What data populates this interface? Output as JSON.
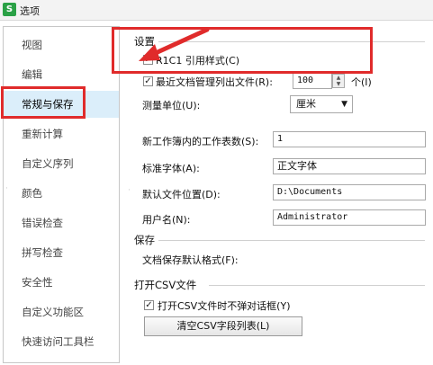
{
  "window": {
    "app_icon_letter": "S",
    "title": "选项"
  },
  "sidebar": {
    "items": [
      {
        "label": "视图"
      },
      {
        "label": "编辑"
      },
      {
        "label": "常规与保存"
      },
      {
        "label": "重新计算"
      },
      {
        "label": "自定义序列"
      },
      {
        "label": "颜色"
      },
      {
        "label": "错误检查"
      },
      {
        "label": "拼写检查"
      },
      {
        "label": "安全性"
      },
      {
        "label": "自定义功能区"
      },
      {
        "label": "快速访问工具栏"
      }
    ],
    "selected_index": 2
  },
  "settings": {
    "section_label": "设置",
    "r1c1": {
      "label": "R1C1 引用样式(C)",
      "checked": true
    },
    "recent_files": {
      "label": "最近文档管理列出文件(R):",
      "value": "100",
      "unit": "个(I)",
      "checked": true
    },
    "measure_unit": {
      "label": "测量单位(U):",
      "value": "厘米"
    },
    "sheets_count": {
      "label": "新工作簿内的工作表数(S):",
      "value": "1"
    },
    "standard_font": {
      "label": "标准字体(A):",
      "value": "正文字体"
    },
    "default_location": {
      "label": "默认文件位置(D):",
      "value": "D:\\Documents"
    },
    "user_name": {
      "label": "用户名(N):",
      "value": "Administrator"
    }
  },
  "save": {
    "section_label": "保存",
    "default_format_label": "文档保存默认格式(F):"
  },
  "csv": {
    "section_label": "打开CSV文件",
    "no_dialog": {
      "label": "打开CSV文件时不弹对话框(Y)",
      "checked": true
    },
    "clear_button_label": "清空CSV字段列表(L)"
  },
  "colors": {
    "highlight": "#e02b2b",
    "selected_bg": "#dbeefa",
    "app_icon": "#2aa146"
  }
}
